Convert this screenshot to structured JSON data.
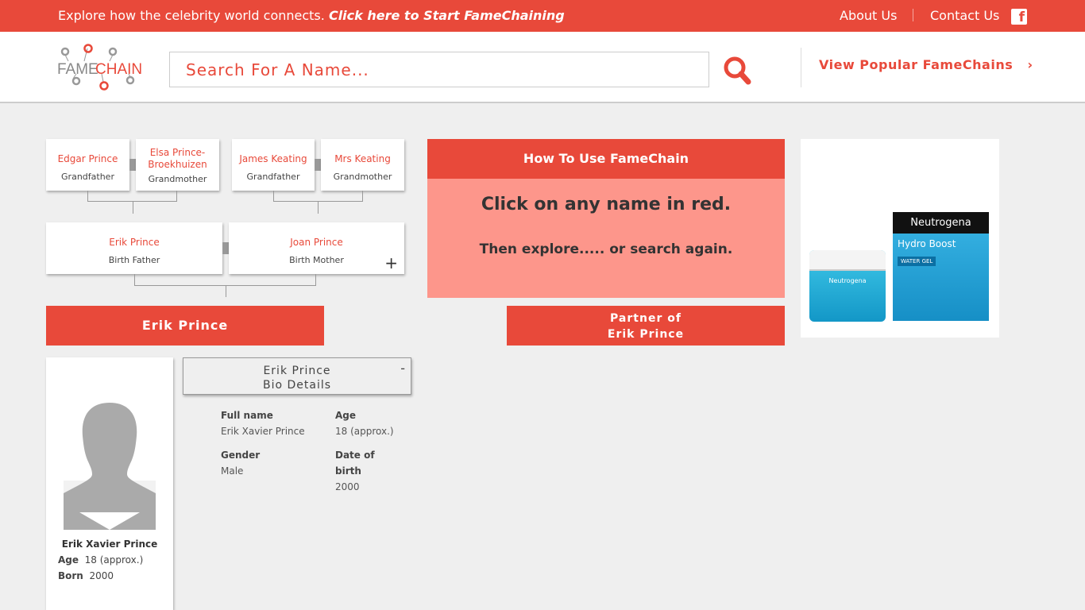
{
  "topbar": {
    "promo_text": "Explore how the celebrity world connects.",
    "promo_link": "Click here to Start FameChaining",
    "about": "About Us",
    "contact": "Contact Us",
    "facebook_icon": "facebook-icon"
  },
  "header": {
    "logo_text_left": "FAME",
    "logo_text_right": "CHAIN",
    "search_placeholder": "Search For A Name...",
    "popular": "View Popular FameChains"
  },
  "tree": {
    "grandparents": [
      {
        "name": "Edgar Prince",
        "role": "Grandfather"
      },
      {
        "name": "Elsa Prince-Broekhuizen",
        "role": "Grandmother"
      },
      {
        "name": "James Keating",
        "role": "Grandfather"
      },
      {
        "name": "Mrs Keating",
        "role": "Grandmother"
      }
    ],
    "parents": [
      {
        "name": "Erik Prince",
        "role": "Birth Father"
      },
      {
        "name": "Joan Prince",
        "role": "Birth Mother"
      }
    ],
    "subject": "Erik Prince",
    "partner_line1": "Partner of",
    "partner_line2": "Erik Prince"
  },
  "howto": {
    "title": "How To Use FameChain",
    "line1": "Click on any name in red.",
    "line2": "Then explore..... or search again."
  },
  "ad": {
    "brand": "Neutrogena",
    "product": "Hydro Boost",
    "variant": "WATER GEL"
  },
  "profile": {
    "full_name": "Erik Xavier Prince",
    "age_label": "Age",
    "age": "18 (approx.)",
    "born_label": "Born",
    "born": "2000"
  },
  "bio": {
    "title1": "Erik Prince",
    "title2": "Bio Details",
    "toggle": "-",
    "full_name_label": "Full name",
    "full_name": "Erik Xavier Prince",
    "age_label": "Age",
    "age": "18 (approx.)",
    "gender_label": "Gender",
    "gender": "Male",
    "dob_label1": "Date of",
    "dob_label2": "birth",
    "dob": "2000"
  },
  "colors": {
    "accent": "#e8493a",
    "howto_bg": "#fd968b",
    "page_bg": "#efefef"
  }
}
